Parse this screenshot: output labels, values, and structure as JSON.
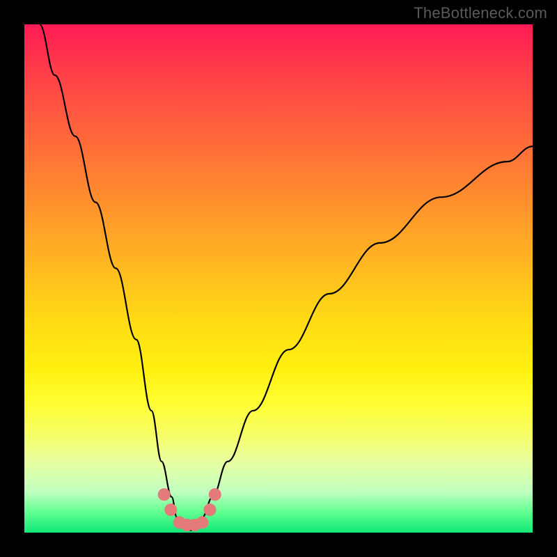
{
  "watermark": "TheBottleneck.com",
  "chart_data": {
    "type": "line",
    "title": "",
    "xlabel": "",
    "ylabel": "",
    "xlim": [
      0,
      100
    ],
    "ylim": [
      0,
      100
    ],
    "series": [
      {
        "name": "bottleneck-curve",
        "x": [
          3,
          6,
          10,
          14,
          18,
          22,
          25,
          27,
          29,
          30,
          31,
          32,
          33,
          34,
          35,
          37,
          40,
          45,
          52,
          60,
          70,
          82,
          95,
          100
        ],
        "y": [
          100,
          90,
          78,
          65,
          52,
          38,
          24,
          14,
          7,
          3,
          1,
          0.5,
          0.5,
          1,
          3,
          7,
          14,
          24,
          36,
          47,
          57,
          66,
          73,
          76
        ]
      }
    ],
    "markers": {
      "name": "highlight-points",
      "x": [
        27.5,
        28.8,
        30.5,
        32,
        33.5,
        35,
        36.5,
        37.5
      ],
      "y": [
        7.5,
        4.5,
        2,
        1.5,
        1.5,
        2,
        4.5,
        7.5
      ]
    },
    "gradient_stops": [
      {
        "pos": 0,
        "color": "#ff1a55"
      },
      {
        "pos": 50,
        "color": "#ffda15"
      },
      {
        "pos": 80,
        "color": "#f8ff60"
      },
      {
        "pos": 100,
        "color": "#10e878"
      }
    ]
  }
}
